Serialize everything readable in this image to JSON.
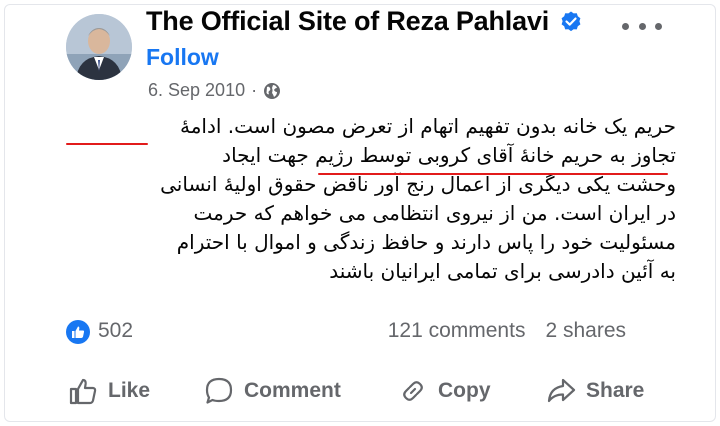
{
  "post": {
    "page_name": "The Official Site of Reza Pahlavi",
    "follow_label": "Follow",
    "date": "6. Sep 2010",
    "separator": "·",
    "body_lines": [
      "حریم یک خانه بدون تفهیم اتهام از تعرض مصون است. ادامهٔ",
      "تجاوز به حریم خانهٔ آقای کروبی توسط رژیم جهت ایجاد",
      "وحشت یکی دیگری از اعمال رنج آور ناقض حقوق اولیهٔ انسانی",
      "در ایران است. من از نیروی انتظامی می خواهم که حرمت",
      "مسئولیت خود را پاس دارند و حافظ زندگی و اموال با احترام",
      "به آئین دادرسی برای تمامی ایرانیان باشند"
    ]
  },
  "stats": {
    "likes": "502",
    "comments": "121 comments",
    "shares": "2 shares"
  },
  "actions": {
    "like": "Like",
    "comment": "Comment",
    "copy": "Copy",
    "share": "Share"
  },
  "colors": {
    "accent": "#1877f2",
    "muted_text": "#65676b",
    "annotation_red": "#e21b1b"
  }
}
